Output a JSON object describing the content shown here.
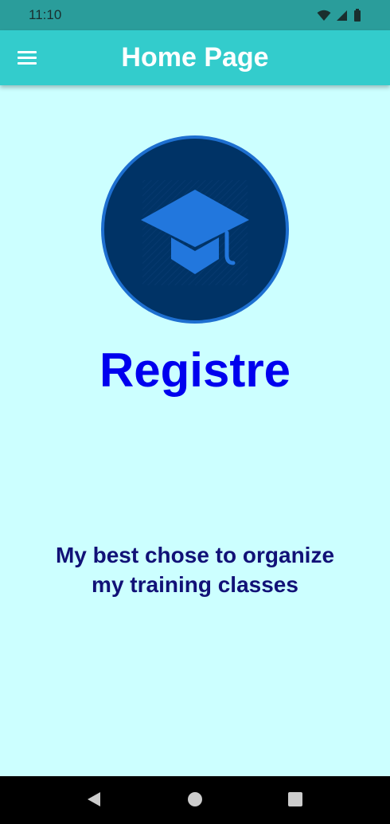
{
  "status_bar": {
    "time": "11:10",
    "icons": [
      "wifi-icon",
      "signal-icon",
      "battery-icon"
    ]
  },
  "app_bar": {
    "menu_icon": "hamburger-menu-icon",
    "title": "Home Page"
  },
  "main": {
    "logo_icon": "graduation-cap-icon",
    "brand": "Registre",
    "tagline": "My best chose to organize my training classes"
  },
  "nav_bar": {
    "back": "back-triangle-icon",
    "home": "home-circle-icon",
    "recents": "recents-square-icon"
  },
  "colors": {
    "status_bar": "#2a9d9b",
    "app_bar": "#33cccc",
    "background": "#ccffff",
    "brand": "#0000ee",
    "tagline": "#111177",
    "logo_circle": "#003366",
    "logo_cap": "#2277dd"
  }
}
